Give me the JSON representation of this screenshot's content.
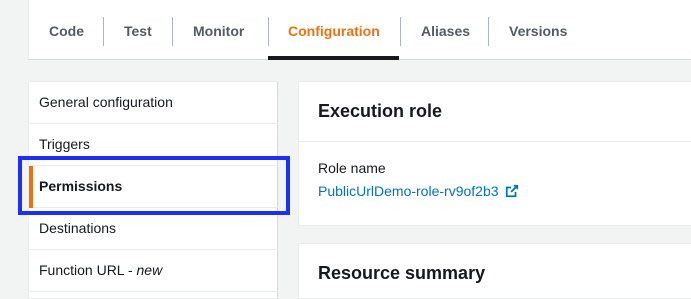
{
  "tabs": [
    {
      "label": "Code",
      "active": false
    },
    {
      "label": "Test",
      "active": false
    },
    {
      "label": "Monitor",
      "active": false
    },
    {
      "label": "Configuration",
      "active": true
    },
    {
      "label": "Aliases",
      "active": false
    },
    {
      "label": "Versions",
      "active": false
    }
  ],
  "sidebar": {
    "items": [
      {
        "label": "General configuration"
      },
      {
        "label": "Triggers"
      },
      {
        "label": "Permissions",
        "active": true
      },
      {
        "label": "Destinations"
      },
      {
        "label": "Function URL - ",
        "tag": "new"
      }
    ]
  },
  "execution_role": {
    "title": "Execution role",
    "role_name_label": "Role name",
    "role_name_value": "PublicUrlDemo-role-rv9of2b3",
    "link_icon": "external-link-icon"
  },
  "resource_summary": {
    "title": "Resource summary"
  },
  "colors": {
    "accent": "#ec7211",
    "link": "#0073bb",
    "highlight": "#1c2ff5"
  }
}
